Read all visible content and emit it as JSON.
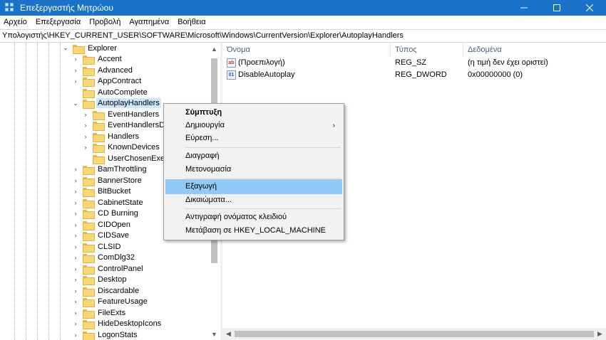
{
  "window": {
    "title": "Επεξεργαστής Μητρώου"
  },
  "menu": [
    "Αρχείο",
    "Επεξεργασία",
    "Προβολή",
    "Αγαπημένα",
    "Βοήθεια"
  ],
  "address": "Υπολογιστής\\HKEY_CURRENT_USER\\SOFTWARE\\Microsoft\\Windows\\CurrentVersion\\Explorer\\AutoplayHandlers",
  "tree": {
    "explorer": "Explorer",
    "children": [
      "Accent",
      "Advanced",
      "AppContract",
      "AutoComplete",
      "AutoplayHandlers",
      "BamThrottling",
      "BannerStore",
      "BitBucket",
      "CabinetState",
      "CD Burning",
      "CIDOpen",
      "CIDSave",
      "CLSID",
      "ComDlg32",
      "ControlPanel",
      "Desktop",
      "Discardable",
      "FeatureUsage",
      "FileExts",
      "HideDesktopIcons",
      "LogonStats"
    ],
    "autoplay_children": [
      "EventHandlers",
      "EventHandlersDefa",
      "Handlers",
      "KnownDevices",
      "UserChosenExecut"
    ],
    "selected": "AutoplayHandlers"
  },
  "list": {
    "columns": [
      "Όνομα",
      "Τύπος",
      "Δεδομένα"
    ],
    "rows": [
      {
        "name": "(Προεπιλογή)",
        "type": "REG_SZ",
        "data": "(η τιμή δεν έχει οριστεί)",
        "icon": "string-value-icon"
      },
      {
        "name": "DisableAutoplay",
        "type": "REG_DWORD",
        "data": "0x00000000 (0)",
        "icon": "binary-value-icon"
      }
    ]
  },
  "context_menu": {
    "collapse": "Σύμπτυξη",
    "new": "Δημιουργία",
    "find": "Εύρεση...",
    "delete": "Διαγραφή",
    "rename": "Μετονομασία",
    "export": "Εξαγωγή",
    "permissions": "Δικαιώματα...",
    "copy_key_name": "Αντιγραφή ονόματος κλειδιού",
    "goto": "Μετάβαση σε HKEY_LOCAL_MACHINE",
    "highlighted": "Εξαγωγή"
  },
  "colors": {
    "titlebar": "#1a73c8",
    "menu_highlight": "#91c9f7",
    "tree_selection": "#cce8ff",
    "folder": "#f8d775"
  }
}
